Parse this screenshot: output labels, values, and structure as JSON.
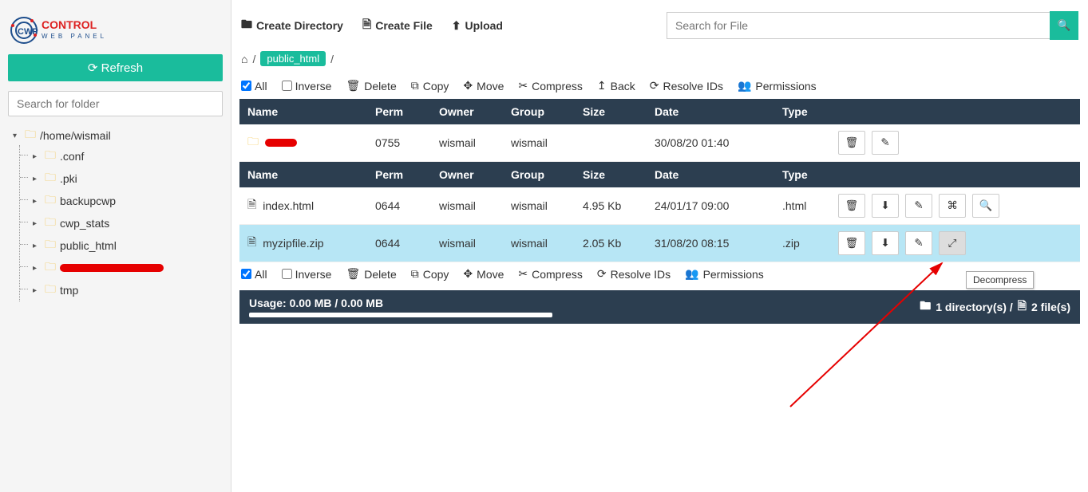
{
  "sidebar": {
    "refresh_label": "Refresh",
    "folder_search_placeholder": "Search for folder",
    "tree": {
      "root": "/home/wismail",
      "children": [
        {
          "label": ".conf"
        },
        {
          "label": ".pki"
        },
        {
          "label": "backupcwp"
        },
        {
          "label": "cwp_stats"
        },
        {
          "label": "public_html"
        },
        {
          "label": "",
          "redacted": true
        },
        {
          "label": "tmp"
        }
      ]
    }
  },
  "topbar": {
    "create_dir": "Create Directory",
    "create_file": "Create File",
    "upload": "Upload",
    "file_search_placeholder": "Search for File"
  },
  "breadcrumb": {
    "current": "public_html"
  },
  "toolbar": {
    "all": "All",
    "inverse": "Inverse",
    "delete": "Delete",
    "copy": "Copy",
    "move": "Move",
    "compress": "Compress",
    "back": "Back",
    "resolve_ids": "Resolve IDs",
    "permissions": "Permissions"
  },
  "columns": {
    "name": "Name",
    "perm": "Perm",
    "owner": "Owner",
    "group": "Group",
    "size": "Size",
    "date": "Date",
    "type": "Type"
  },
  "dir_row": {
    "perm": "0755",
    "owner": "wismail",
    "group": "wismail",
    "size": "",
    "date": "30/08/20 01:40",
    "type": ""
  },
  "file_rows": [
    {
      "name": "index.html",
      "perm": "0644",
      "owner": "wismail",
      "group": "wismail",
      "size": "4.95 Kb",
      "date": "24/01/17 09:00",
      "type": ".html",
      "highlight": false
    },
    {
      "name": "myzipfile.zip",
      "perm": "0644",
      "owner": "wismail",
      "group": "wismail",
      "size": "2.05 Kb",
      "date": "31/08/20 08:15",
      "type": ".zip",
      "highlight": true
    }
  ],
  "status": {
    "usage": "Usage: 0.00 MB / 0.00 MB",
    "progress_pct": 100,
    "dirs_label": "1 directory(s) /",
    "files_label": "2 file(s)"
  },
  "tooltip": {
    "text": "Decompress"
  }
}
